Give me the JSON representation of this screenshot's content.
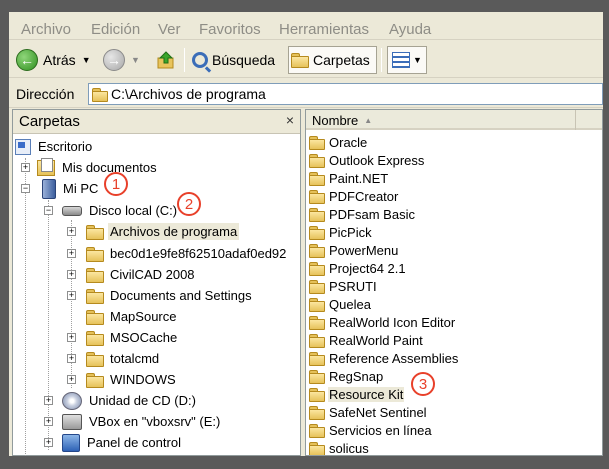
{
  "menu": [
    "Archivo",
    "Edición",
    "Ver",
    "Favoritos",
    "Herramientas",
    "Ayuda"
  ],
  "toolbar": {
    "back_label": "Atrás",
    "search_label": "Búsqueda",
    "folders_label": "Carpetas"
  },
  "address": {
    "label": "Dirección",
    "value": "C:\\Archivos de programa"
  },
  "folders_pane": {
    "title": "Carpetas",
    "close": "×",
    "tree": [
      {
        "label": "Escritorio",
        "icon": "desktop-icon"
      },
      {
        "label": "Mis documentos",
        "icon": "my-documents-icon"
      },
      {
        "label": "Mi PC",
        "icon": "computer-icon"
      },
      {
        "label": "Disco local (C:)",
        "icon": "hard-disk-icon"
      },
      {
        "label": "Archivos de programa",
        "icon": "folder-icon",
        "selected": true
      },
      {
        "label": "bec0d1e9fe8f62510adaf0ed92",
        "icon": "folder-icon"
      },
      {
        "label": "CivilCAD 2008",
        "icon": "folder-icon"
      },
      {
        "label": "Documents and Settings",
        "icon": "folder-icon"
      },
      {
        "label": "MapSource",
        "icon": "folder-icon"
      },
      {
        "label": "MSOCache",
        "icon": "folder-icon"
      },
      {
        "label": "totalcmd",
        "icon": "folder-icon"
      },
      {
        "label": "WINDOWS",
        "icon": "folder-icon"
      },
      {
        "label": "Unidad de CD (D:)",
        "icon": "cd-drive-icon"
      },
      {
        "label": "VBox en \"vboxsrv\" (E:)",
        "icon": "network-drive-icon"
      },
      {
        "label": "Panel de control",
        "icon": "control-panel-icon"
      }
    ]
  },
  "files_pane": {
    "column_name": "Nombre",
    "items": [
      "Oracle",
      "Outlook Express",
      "Paint.NET",
      "PDFCreator",
      "PDFsam Basic",
      "PicPick",
      "PowerMenu",
      "Project64 2.1",
      "PSRUTI",
      "Quelea",
      "RealWorld Icon Editor",
      "RealWorld Paint",
      "Reference Assemblies",
      "RegSnap",
      "Resource Kit",
      "SafeNet Sentinel",
      "Servicios en línea",
      "solicus"
    ]
  },
  "markers": [
    "1",
    "2",
    "3"
  ],
  "colors": {
    "marker": "#e8402a",
    "window_bg": "#ece9d8",
    "address_border": "#7f9db9"
  }
}
